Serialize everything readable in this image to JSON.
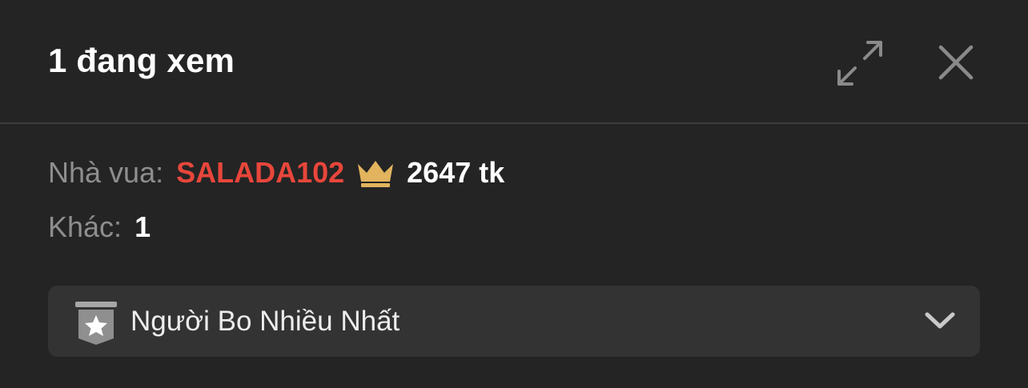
{
  "header": {
    "title": "1 đang xem",
    "expand_icon": "expand-icon",
    "close_icon": "close-icon"
  },
  "stats": {
    "king_label": "Nhà vua:",
    "king_name": "SALADA102",
    "king_icon": "crown-icon",
    "king_amount": "2647 tk",
    "other_label": "Khác:",
    "other_count": "1"
  },
  "dropdown": {
    "icon": "star-badge-icon",
    "selected": "Người Bo Nhiều Nhất",
    "chevron_icon": "chevron-down-icon"
  },
  "colors": {
    "background": "#242424",
    "panel": "#333333",
    "king_name": "#e8463b",
    "crown": "#e2b45d",
    "muted_text": "#8e8e8e"
  }
}
